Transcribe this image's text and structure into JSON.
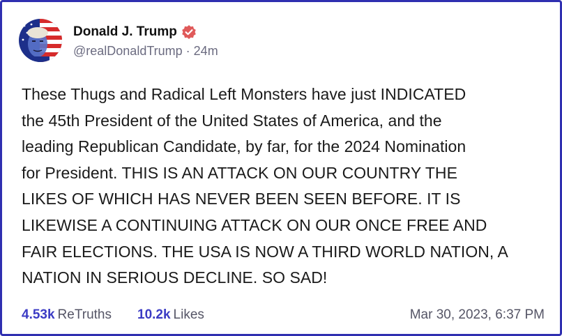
{
  "author": {
    "display_name": "Donald J. Trump",
    "handle": "@realDonaldTrump",
    "time_ago": "24m",
    "verified": true,
    "avatar_icon": "profile-avatar",
    "verified_icon": "verified-badge-icon",
    "verified_color": "#e05a5a"
  },
  "post": {
    "text": "These Thugs and Radical Left Monsters have just INDICATED\nthe 45th President of the United States of America, and the\nleading Republican Candidate, by far, for the 2024 Nomination\nfor President. THIS IS AN ATTACK ON OUR COUNTRY THE\nLIKES OF WHICH HAS NEVER BEEN SEEN BEFORE. IT IS\nLIKEWISE A CONTINUING ATTACK ON OUR ONCE FREE AND\nFAIR ELECTIONS. THE USA IS NOW A THIRD WORLD NATION, A\nNATION IN SERIOUS DECLINE. SO SAD!"
  },
  "stats": {
    "retruths_count": "4.53k",
    "retruths_label": "ReTruths",
    "likes_count": "10.2k",
    "likes_label": "Likes",
    "timestamp": "Mar 30, 2023, 6:37 PM"
  },
  "colors": {
    "frame_border": "#2f2fb0",
    "stat_accent": "#3b3bc4",
    "meta_text": "#6b6b80"
  }
}
